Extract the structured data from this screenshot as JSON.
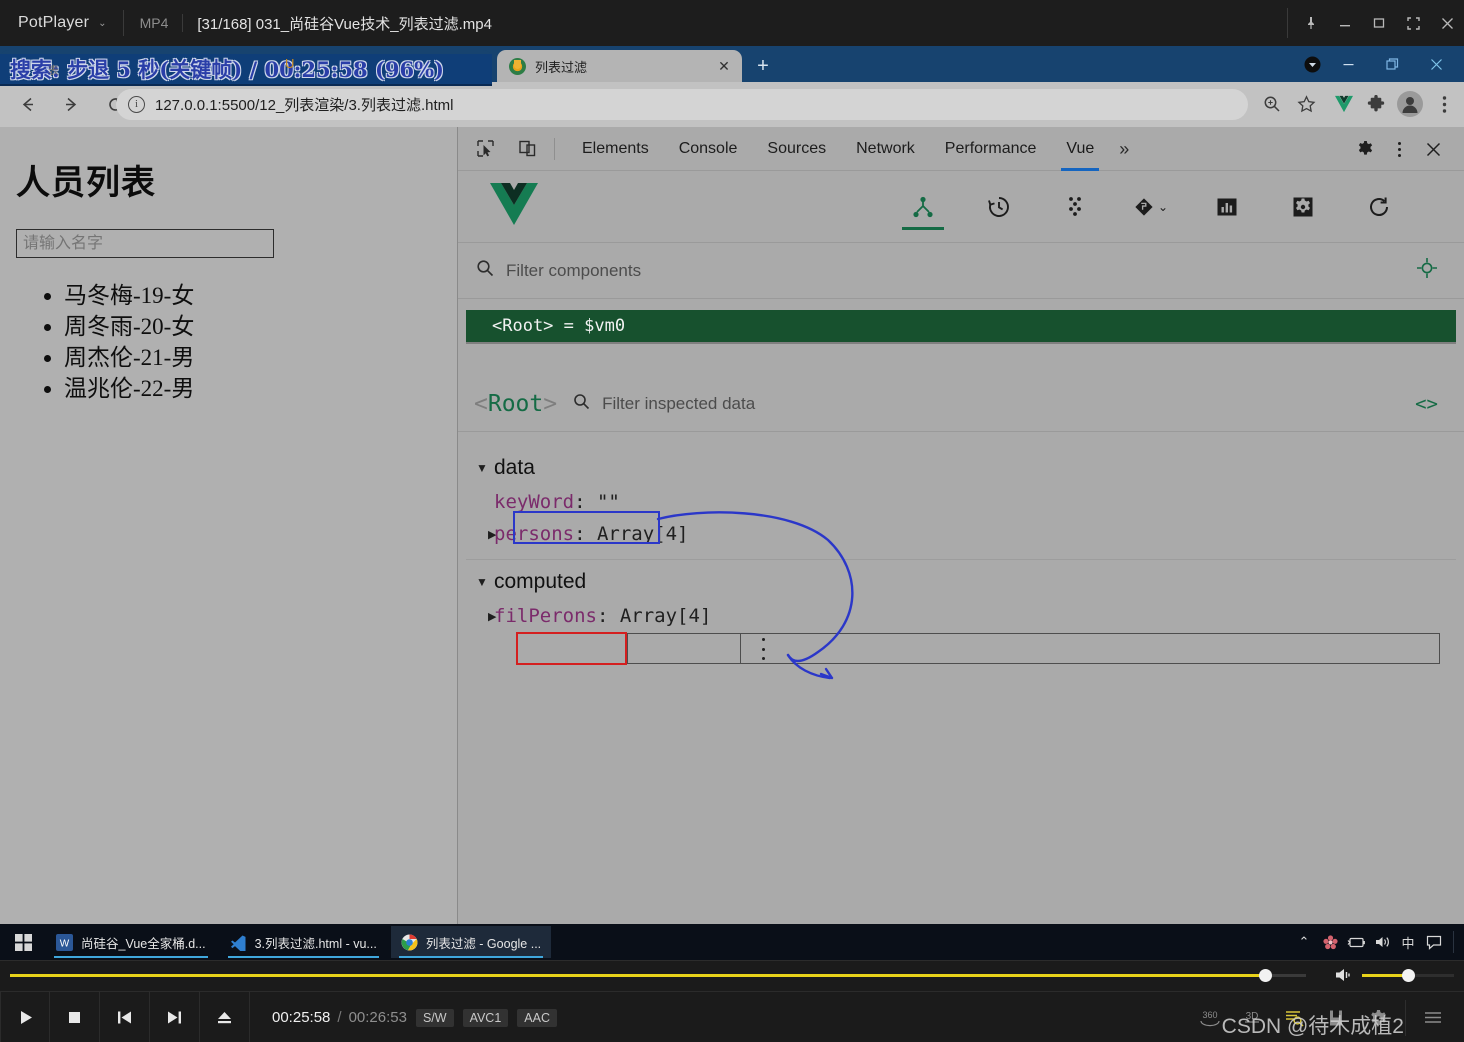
{
  "potplayer": {
    "app_name": "PotPlayer",
    "caret": "⌄",
    "format": "MP4",
    "file_name": "[31/168] 031_尚硅谷Vue技术_列表过滤.mp4",
    "window_buttons": [
      "pin",
      "minimize",
      "maximize",
      "fullscreen",
      "close"
    ],
    "osd_text": "搜索: 步退 5 秒(关键帧) / 00:25:58 (96%)",
    "osd_ghost": "表",
    "osd_ghost2": "U",
    "controls": {
      "time_current": "00:25:58",
      "time_separator": "/",
      "time_total": "00:26:53",
      "chips": [
        "S/W",
        "AVC1",
        "AAC"
      ],
      "buttons": [
        "play",
        "stop",
        "previous",
        "next",
        "eject"
      ],
      "right_buttons": [
        "360",
        "3D",
        "search-list",
        "bookmark",
        "settings",
        "playlist"
      ],
      "seek_percent": 96,
      "volume_percent": 50
    },
    "watermark": "CSDN @待木成植2"
  },
  "chrome": {
    "tab": {
      "title": "列表过滤",
      "close_label": "✕"
    },
    "newtab_label": "+",
    "hidden_tab_close": "✕",
    "window_buttons": [
      "minimize",
      "restore",
      "close"
    ],
    "nav": {
      "back": "←",
      "forward": "→",
      "reload": "⟳"
    },
    "omnibox": {
      "info_glyph": "i",
      "url": "127.0.0.1:5500/12_列表渲染/3.列表过滤.html"
    },
    "toolbar_icons": [
      "zoom-icon",
      "bookmark-star-icon",
      "vue-devtools-icon",
      "extensions-puzzle-icon",
      "profile-avatar-icon",
      "chrome-menu-icon"
    ]
  },
  "page": {
    "title": "人员列表",
    "input_placeholder": "请输入名字",
    "input_value": "",
    "persons": [
      "马冬梅-19-女",
      "周冬雨-20-女",
      "周杰伦-21-男",
      "温兆伦-22-男"
    ]
  },
  "devtools": {
    "inspect_icon": "inspect-element-icon",
    "device_icon": "device-toolbar-icon",
    "tabs": [
      {
        "label": "Elements",
        "active": false
      },
      {
        "label": "Console",
        "active": false
      },
      {
        "label": "Sources",
        "active": false
      },
      {
        "label": "Network",
        "active": false
      },
      {
        "label": "Performance",
        "active": false
      },
      {
        "label": "Vue",
        "active": true
      }
    ],
    "more_tabs_label": "»",
    "right_icons": [
      "settings-gear-icon",
      "devtools-menu-icon",
      "close-devtools-icon"
    ],
    "vue_panel": {
      "logo": "vue-logo",
      "actions": [
        {
          "name": "components-tree-icon",
          "active": true
        },
        {
          "name": "timeline-history-icon",
          "active": false
        },
        {
          "name": "state-dots-icon",
          "active": false
        },
        {
          "name": "routes-diamond-icon",
          "active": false,
          "caret": "⌄"
        },
        {
          "name": "performance-bars-icon",
          "active": false
        },
        {
          "name": "settings-gear-icon",
          "active": false
        },
        {
          "name": "refresh-icon",
          "active": false
        }
      ],
      "filter_placeholder": "Filter components",
      "select-target-icon": "select-component-target-icon",
      "component_tree": [
        {
          "label": "<Root> = $vm0",
          "selected": true
        }
      ],
      "inspector": {
        "root_open": "<",
        "root_name": "Root",
        "root_close": ">",
        "filter_placeholder": "Filter inspected data",
        "code_icon": "<>",
        "groups": [
          {
            "name": "data",
            "caret": "▼",
            "props": [
              {
                "caret": "",
                "key": "keyWord",
                "value": ": \"\"",
                "boxed": "blue"
              },
              {
                "caret": "▶",
                "key": "persons",
                "value": ": Array[4]",
                "boxed": ""
              }
            ]
          },
          {
            "name": "computed",
            "caret": "▼",
            "props": [
              {
                "caret": "▶",
                "key": "filPerons",
                "value": ": Array[4]",
                "boxed": "red"
              }
            ]
          }
        ]
      }
    }
  },
  "taskbar": {
    "start_icon": "windows-start-icon",
    "items": [
      {
        "label": "尚硅谷_Vue全家桶.d...",
        "icon": "word-icon",
        "active": false
      },
      {
        "label": "3.列表过滤.html - vu...",
        "icon": "vscode-icon",
        "active": false
      },
      {
        "label": "列表过滤 - Google ...",
        "icon": "chrome-icon",
        "active": true
      }
    ],
    "tray": {
      "chevron": "⌃",
      "icons": [
        "app-flower-icon",
        "battery-icon",
        "volume-icon"
      ],
      "ime": "中",
      "notification": "notification-icon"
    }
  },
  "colors": {
    "vue_green": "#156b45",
    "tree_selected": "#17512e",
    "devtools_accent": "#1565c0",
    "annotation_blue": "#2b37c9",
    "annotation_red": "#d41f1f",
    "seek_yellow": "#e8d21a"
  }
}
